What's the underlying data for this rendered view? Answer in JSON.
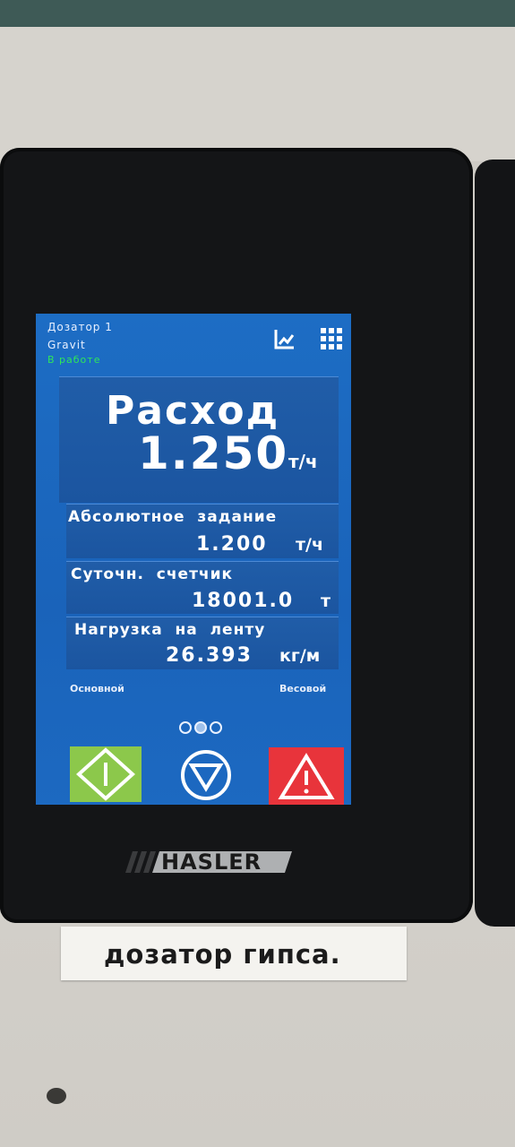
{
  "header": {
    "device_name": "Дозатор 1",
    "mode": "Gravit",
    "status": "В работе"
  },
  "icons": {
    "trend": "trend-icon",
    "menu": "grid-menu-icon",
    "start": "start-icon",
    "stop": "stop-icon",
    "alarm": "alarm-icon"
  },
  "main": {
    "title": "Расход",
    "value": "1.250",
    "unit": "т/ч"
  },
  "rows": [
    {
      "label": "Абсолютное  задание",
      "value": "1.200",
      "unit": "т/ч"
    },
    {
      "label": "Суточн.  счетчик",
      "value": "18001.0",
      "unit": "т"
    },
    {
      "label": "Нагрузка  на  ленту",
      "value": "26.393",
      "unit": "кг/м"
    }
  ],
  "footer": {
    "left": "Основной",
    "right": "Весовой"
  },
  "pager": {
    "pages": 3,
    "active": 2
  },
  "brand": {
    "logo_text": "HASLER"
  },
  "plate": {
    "text": "дозатор гипса."
  },
  "colors": {
    "screen": "#1d6dc4",
    "status": "#2ee65a",
    "start": "#8cc84b",
    "alarm": "#e8343b"
  }
}
